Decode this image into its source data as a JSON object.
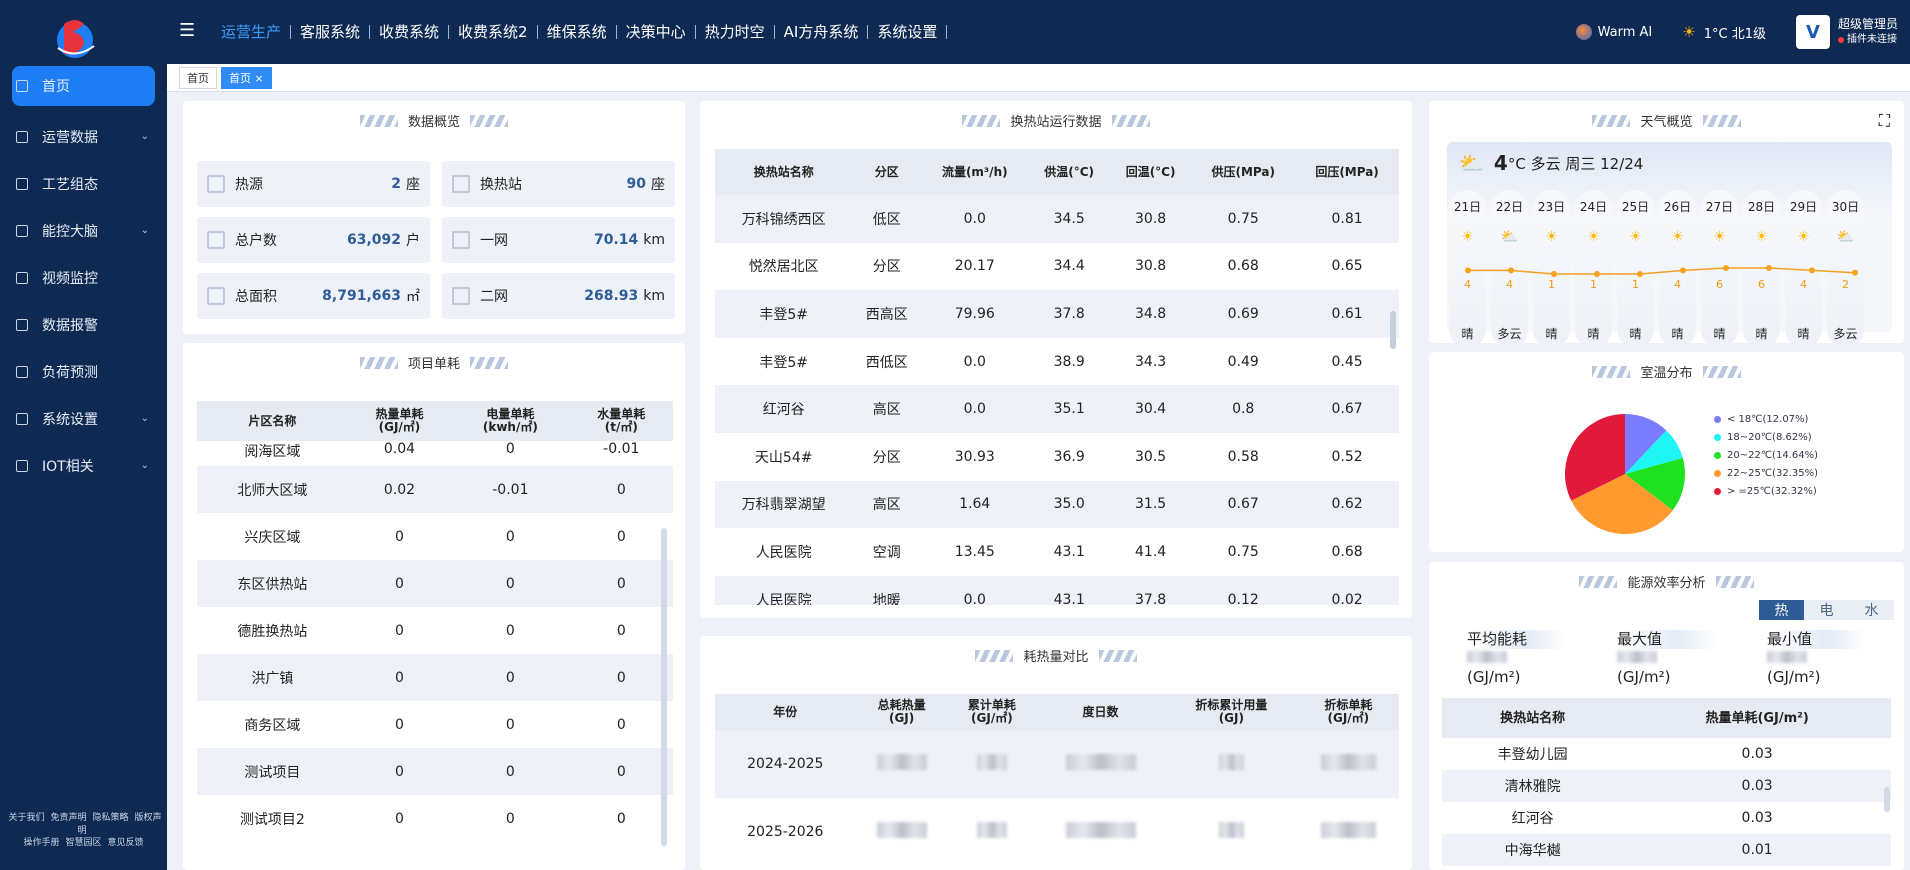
{
  "app": {
    "brand_colors": {
      "nav_bg": "#0e2a52",
      "accent": "#1e7ef5"
    }
  },
  "topnav": {
    "items": [
      "运营生产",
      "客服系统",
      "收费系统",
      "收费系统2",
      "维保系统",
      "决策中心",
      "热力时空",
      "AI方舟系统",
      "系统设置"
    ],
    "active": 0
  },
  "topright": {
    "warm_ai": "Warm AI",
    "weather": "1°C 北1级",
    "user_name": "超级管理员",
    "user_status": "插件未连接"
  },
  "sidebar": {
    "items": [
      {
        "label": "首页",
        "icon": "home-icon",
        "active": true
      },
      {
        "label": "运营数据",
        "icon": "grid-icon",
        "expand": true
      },
      {
        "label": "工艺组态",
        "icon": "flow-icon"
      },
      {
        "label": "能控大脑",
        "icon": "grid-icon",
        "expand": true
      },
      {
        "label": "视频监控",
        "icon": "grid-icon"
      },
      {
        "label": "数据报警",
        "icon": "alarm-icon"
      },
      {
        "label": "负荷预测",
        "icon": "grid-icon"
      },
      {
        "label": "系统设置",
        "icon": "gear-icon",
        "expand": true
      },
      {
        "label": "IOT相关",
        "icon": "grid-icon",
        "expand": true
      }
    ],
    "footer_row1": [
      "关于我们",
      "免责声明",
      "隐私策略",
      "版权声明"
    ],
    "footer_row2": [
      "操作手册",
      "智慧园区",
      "意见反馈"
    ]
  },
  "tabs": [
    "首页",
    "首页 ×"
  ],
  "overview": {
    "title": "数据概览",
    "stats": [
      {
        "label": "热源",
        "value": "2",
        "unit": "座",
        "icon": "heat-source-icon"
      },
      {
        "label": "换热站",
        "value": "90",
        "unit": "座",
        "icon": "station-icon"
      },
      {
        "label": "总户数",
        "value": "63,092",
        "unit": "户",
        "icon": "building-icon"
      },
      {
        "label": "一网",
        "value": "70.14",
        "unit": "km",
        "icon": "pipe-icon"
      },
      {
        "label": "总面积",
        "value": "8,791,663",
        "unit": "㎡",
        "icon": "area-icon"
      },
      {
        "label": "二网",
        "value": "268.93",
        "unit": "km",
        "icon": "pipe-icon"
      }
    ]
  },
  "project": {
    "title": "项目单耗",
    "headers": [
      "片区名称",
      "热量单耗\n(GJ/㎡)",
      "电量单耗\n(kwh/㎡)",
      "水量单耗\n(t/㎡)"
    ],
    "rows": [
      [
        "阅海区域",
        "0.04",
        "0",
        "-0.01"
      ],
      [
        "北师大区域",
        "0.02",
        "-0.01",
        "0"
      ],
      [
        "兴庆区域",
        "0",
        "0",
        "0"
      ],
      [
        "东区供热站",
        "0",
        "0",
        "0"
      ],
      [
        "德胜换热站",
        "0",
        "0",
        "0"
      ],
      [
        "洪广镇",
        "0",
        "0",
        "0"
      ],
      [
        "商务区域",
        "0",
        "0",
        "0"
      ],
      [
        "测试项目",
        "0",
        "0",
        "0"
      ],
      [
        "测试项目2",
        "0",
        "0",
        "0"
      ]
    ]
  },
  "station": {
    "title": "换热站运行数据",
    "headers": [
      "换热站名称",
      "分区",
      "流量(m³/h)",
      "供温(°C)",
      "回温(°C)",
      "供压(MPa)",
      "回压(MPa)"
    ],
    "rows": [
      [
        "万科锦绣西区",
        "低区",
        "0.0",
        "34.5",
        "30.8",
        "0.75",
        "0.81"
      ],
      [
        "悦然居北区",
        "分区",
        "20.17",
        "34.4",
        "30.8",
        "0.68",
        "0.65"
      ],
      [
        "丰登5#",
        "西高区",
        "79.96",
        "37.8",
        "34.8",
        "0.69",
        "0.61"
      ],
      [
        "丰登5#",
        "西低区",
        "0.0",
        "38.9",
        "34.3",
        "0.49",
        "0.45"
      ],
      [
        "红河谷",
        "高区",
        "0.0",
        "35.1",
        "30.4",
        "0.8",
        "0.67"
      ],
      [
        "天山54#",
        "分区",
        "30.93",
        "36.9",
        "30.5",
        "0.58",
        "0.52"
      ],
      [
        "万科翡翠湖望",
        "高区",
        "1.64",
        "35.0",
        "31.5",
        "0.67",
        "0.62"
      ],
      [
        "人民医院",
        "空调",
        "13.45",
        "43.1",
        "41.4",
        "0.75",
        "0.68"
      ],
      [
        "人民医院",
        "地暖",
        "0.0",
        "43.1",
        "37.8",
        "0.12",
        "0.02"
      ]
    ]
  },
  "heatcmp": {
    "title": "耗热量对比",
    "headers": [
      "年份",
      "总耗热量\n(GJ)",
      "累计单耗\n(GJ/㎡)",
      "度日数",
      "折标累计用量\n(GJ)",
      "折标单耗\n(GJ/㎡)"
    ],
    "rows": [
      [
        "2024-2025"
      ],
      [
        "2025-2026"
      ]
    ]
  },
  "weather": {
    "title": "天气概览",
    "current": "4°C 多云 周三 12/24",
    "current_temp": "4",
    "current_text": "°C 多云 周三 12/24",
    "days": [
      {
        "d": "21日",
        "t": "4",
        "c": "晴",
        "i": "sun-icon"
      },
      {
        "d": "22日",
        "t": "4",
        "c": "多云",
        "i": "cloud-icon"
      },
      {
        "d": "23日",
        "t": "1",
        "c": "晴",
        "i": "sun-icon"
      },
      {
        "d": "24日",
        "t": "1",
        "c": "晴",
        "i": "sun-icon"
      },
      {
        "d": "25日",
        "t": "1",
        "c": "晴",
        "i": "sun-icon"
      },
      {
        "d": "26日",
        "t": "4",
        "c": "晴",
        "i": "sun-icon"
      },
      {
        "d": "27日",
        "t": "6",
        "c": "晴",
        "i": "sun-icon"
      },
      {
        "d": "28日",
        "t": "6",
        "c": "晴",
        "i": "sun-icon"
      },
      {
        "d": "29日",
        "t": "4",
        "c": "晴",
        "i": "sun-icon"
      },
      {
        "d": "30日",
        "t": "2",
        "c": "多云",
        "i": "cloud-icon"
      }
    ]
  },
  "room": {
    "title": "室温分布"
  },
  "energy": {
    "title": "能源效率分析",
    "seg": [
      "热",
      "电",
      "水"
    ],
    "metrics": [
      {
        "label": "平均能耗",
        "unit": "(GJ/m²)"
      },
      {
        "label": "最大值",
        "unit": "(GJ/m²)"
      },
      {
        "label": "最小值",
        "unit": "(GJ/m²)"
      }
    ],
    "headers": [
      "换热站名称",
      "热量单耗(GJ/m²)"
    ],
    "rows": [
      [
        "丰登幼儿园",
        "0.03"
      ],
      [
        "清林雅院",
        "0.03"
      ],
      [
        "红河谷",
        "0.03"
      ],
      [
        "中海华樾",
        "0.01"
      ]
    ]
  },
  "chart_data": {
    "type": "pie",
    "series": [
      {
        "name": "< 18℃",
        "value": 12.07,
        "color": "#7b7bff",
        "label": "< 18℃(12.07%)"
      },
      {
        "name": "18~20℃",
        "value": 8.62,
        "color": "#1ef5f5",
        "label": "18~20℃(8.62%)"
      },
      {
        "name": "20~22℃",
        "value": 14.64,
        "color": "#1fe11f",
        "label": "20~22℃(14.64%)"
      },
      {
        "name": "22~25℃",
        "value": 32.35,
        "color": "#ff9a2e",
        "label": "22~25℃(32.35%)"
      },
      {
        "name": "> =25℃",
        "value": 32.32,
        "color": "#e11a3c",
        "label": "> =25℃(32.32%)"
      }
    ]
  }
}
